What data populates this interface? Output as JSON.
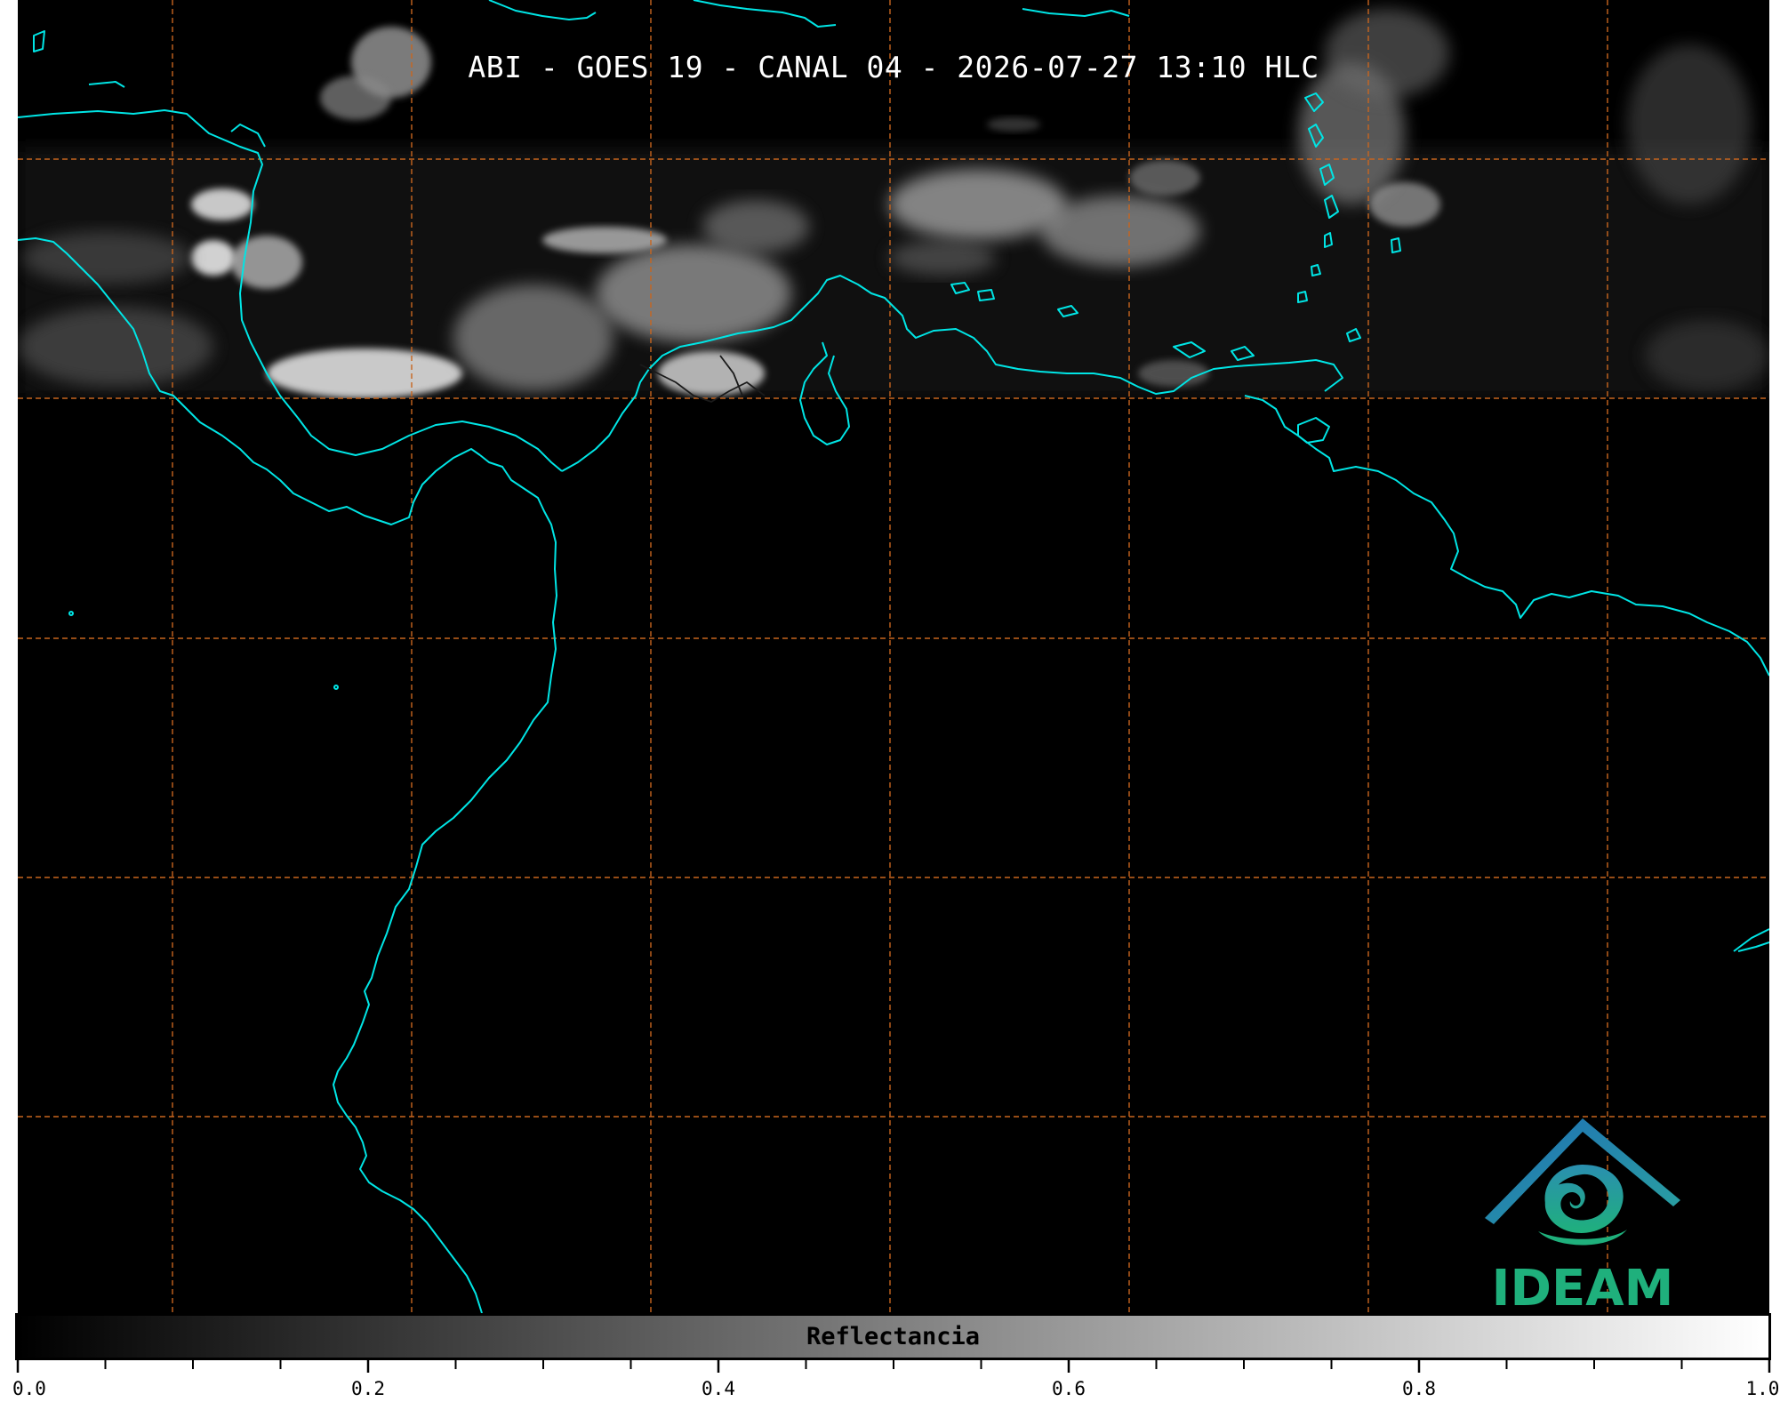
{
  "title": "ABI - GOES 19 - CANAL 04 - 2026-07-27 13:10 HLC",
  "colorbar": {
    "label": "Reflectancia",
    "min": 0.0,
    "max": 1.0,
    "tick_labels": [
      "0.0",
      "0.2",
      "0.4",
      "0.6",
      "0.8",
      "1.0"
    ],
    "gradient_start": "#000000",
    "gradient_end": "#ffffff"
  },
  "logo": {
    "text": "IDEAM",
    "text_color": "#1fb07c",
    "roof_color": "#1f6fb5"
  },
  "colors": {
    "background": "#000000",
    "coastline": "#00e5e5",
    "gridlines": "#c8651e",
    "borders": "#111111"
  }
}
